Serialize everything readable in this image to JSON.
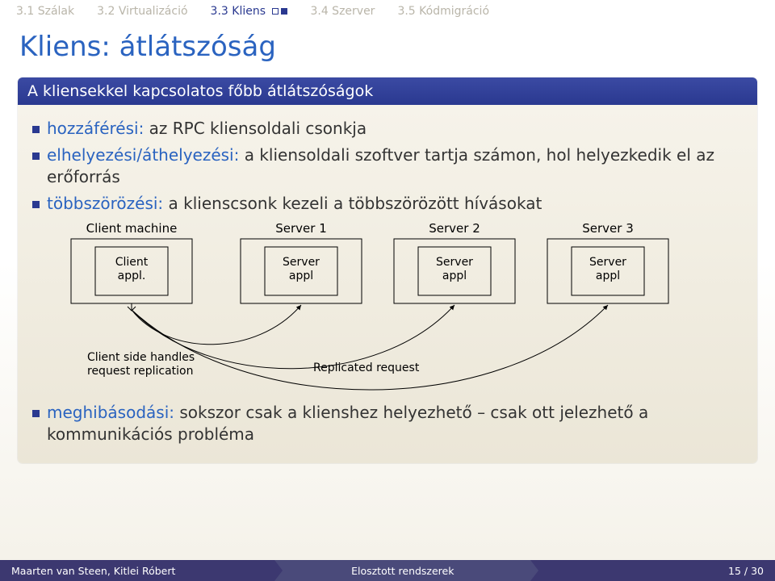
{
  "nav": {
    "items": [
      {
        "label": "3.1 Szálak"
      },
      {
        "label": "3.2 Virtualizáció"
      },
      {
        "label": "3.3 Kliens",
        "active": true
      },
      {
        "label": "3.4 Szerver"
      },
      {
        "label": "3.5 Kódmigráció"
      }
    ]
  },
  "title": "Kliens: átlátszóság",
  "block": {
    "title": "A kliensekkel kapcsolatos főbb átlátszóságok",
    "bullets": [
      {
        "term": "hozzáférési:",
        "rest": " az RPC kliensoldali csonkja"
      },
      {
        "term": "elhelyezési/áthelyezési:",
        "rest": " a kliensoldali szoftver tartja számon, hol helyezkedik el az erőforrás"
      },
      {
        "term": "többszörözési:",
        "rest": " a klienscsonk kezeli a többszörözött hívásokat"
      },
      {
        "term": "meghibásodási:",
        "rest": " sokszor csak a klienshez helyezhető – csak ott jelezhető a kommunikációs probléma"
      }
    ]
  },
  "diagram": {
    "cols": [
      "Client machine",
      "Server 1",
      "Server 2",
      "Server 3"
    ],
    "inner": [
      "Client\nappl.",
      "Server\nappl",
      "Server\nappl",
      "Server\nappl"
    ],
    "caption_left": "Client side handles\nrequest replication",
    "caption_right": "Replicated request"
  },
  "footer": {
    "authors": "Maarten van Steen, Kitlei Róbert",
    "course": "Elosztott rendszerek",
    "page": "15 / 30"
  }
}
